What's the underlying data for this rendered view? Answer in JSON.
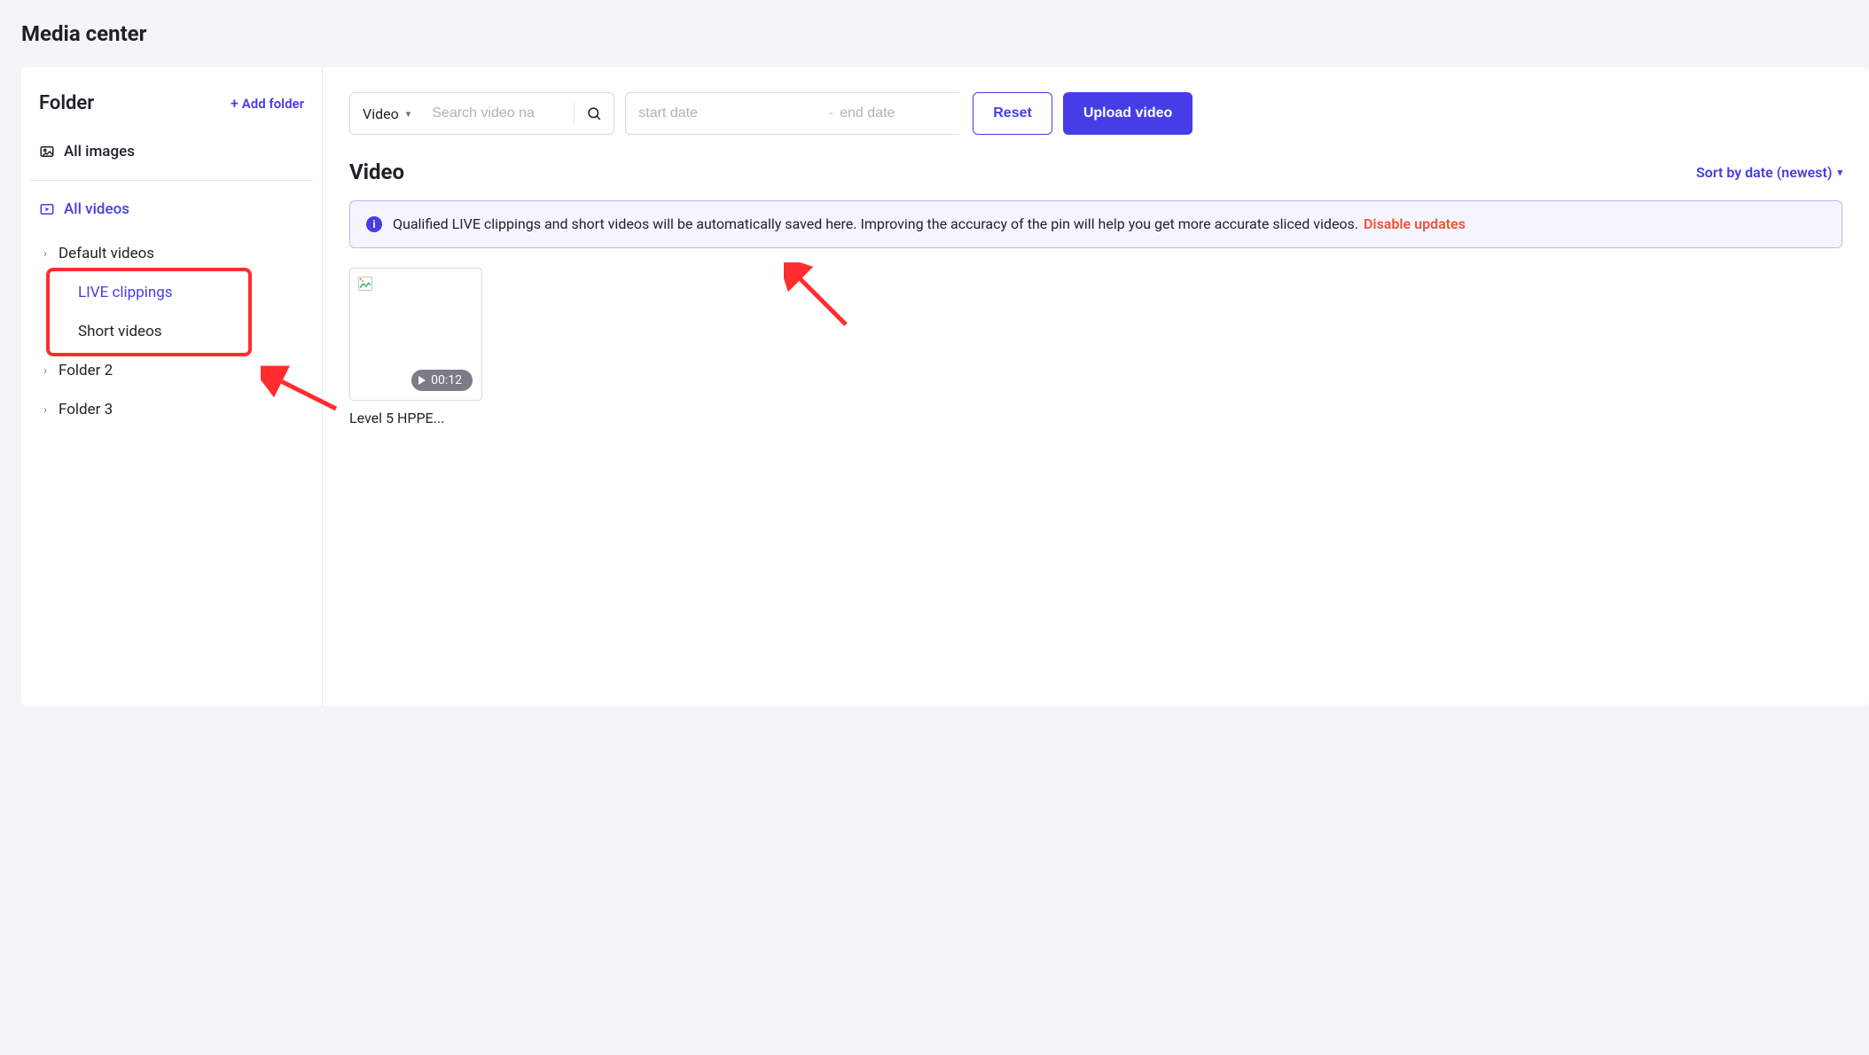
{
  "page": {
    "title": "Media center"
  },
  "sidebar": {
    "heading": "Folder",
    "add_label": "Add folder",
    "all_images": "All images",
    "all_videos": "All videos",
    "tree": {
      "default_videos": "Default videos",
      "live_clippings": "LIVE clippings",
      "short_videos": "Short videos",
      "folder2": "Folder 2",
      "folder3": "Folder 3"
    }
  },
  "toolbar": {
    "type_label": "Video",
    "search_placeholder": "Search video na",
    "start_placeholder": "start date",
    "end_placeholder": "end date",
    "reset": "Reset",
    "upload": "Upload video"
  },
  "section": {
    "heading": "Video",
    "sort_label": "Sort by date (newest)"
  },
  "banner": {
    "text": "Qualified LIVE clippings and short videos will be automatically saved here. Improving the accuracy of the pin will help you get more accurate sliced videos.",
    "disable": "Disable updates"
  },
  "videos": [
    {
      "title": "Level 5 HPPE...",
      "duration": "00:12"
    }
  ]
}
